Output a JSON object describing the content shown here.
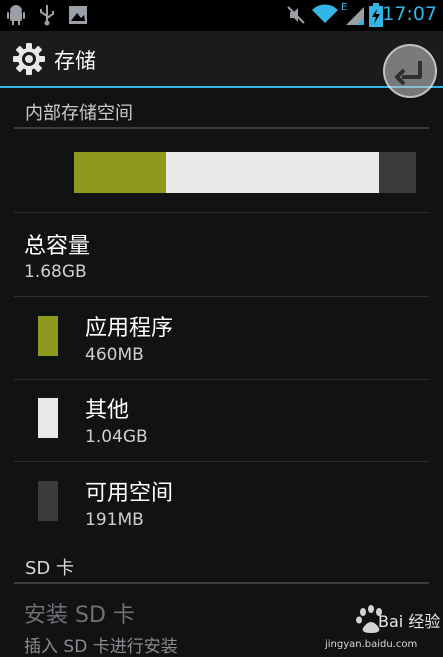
{
  "status_bar": {
    "time": "17:07",
    "network_type": "E",
    "icons": [
      "android-debug-icon",
      "usb-icon",
      "gallery-notification-icon",
      "mute-icon",
      "wifi-icon",
      "signal-icon",
      "battery-charging-icon"
    ]
  },
  "action_bar": {
    "title": "存储",
    "icon": "gear-icon"
  },
  "internal_storage": {
    "header": "内部存储空间",
    "usage_bar": [
      {
        "name": "应用程序",
        "fraction": 0.268,
        "color": "#8f9a1d"
      },
      {
        "name": "其他",
        "fraction": 0.624,
        "color": "#e8e8e8"
      },
      {
        "name": "可用空间",
        "fraction": 0.108,
        "color": "#3a3b3d"
      }
    ],
    "total": {
      "label": "总容量",
      "value": "1.68GB"
    },
    "items": [
      {
        "label": "应用程序",
        "value": "460MB",
        "color": "#8f9a1d"
      },
      {
        "label": "其他",
        "value": "1.04GB",
        "color": "#e8e8e8"
      },
      {
        "label": "可用空间",
        "value": "191MB",
        "color": "#3a3b3d"
      }
    ]
  },
  "sd_card": {
    "header": "SD 卡",
    "install_title": "安装 SD 卡",
    "install_hint": "插入 SD 卡进行安装"
  },
  "watermark": {
    "brand": "Bai 经验",
    "url": "jingyan.baidu.com"
  }
}
